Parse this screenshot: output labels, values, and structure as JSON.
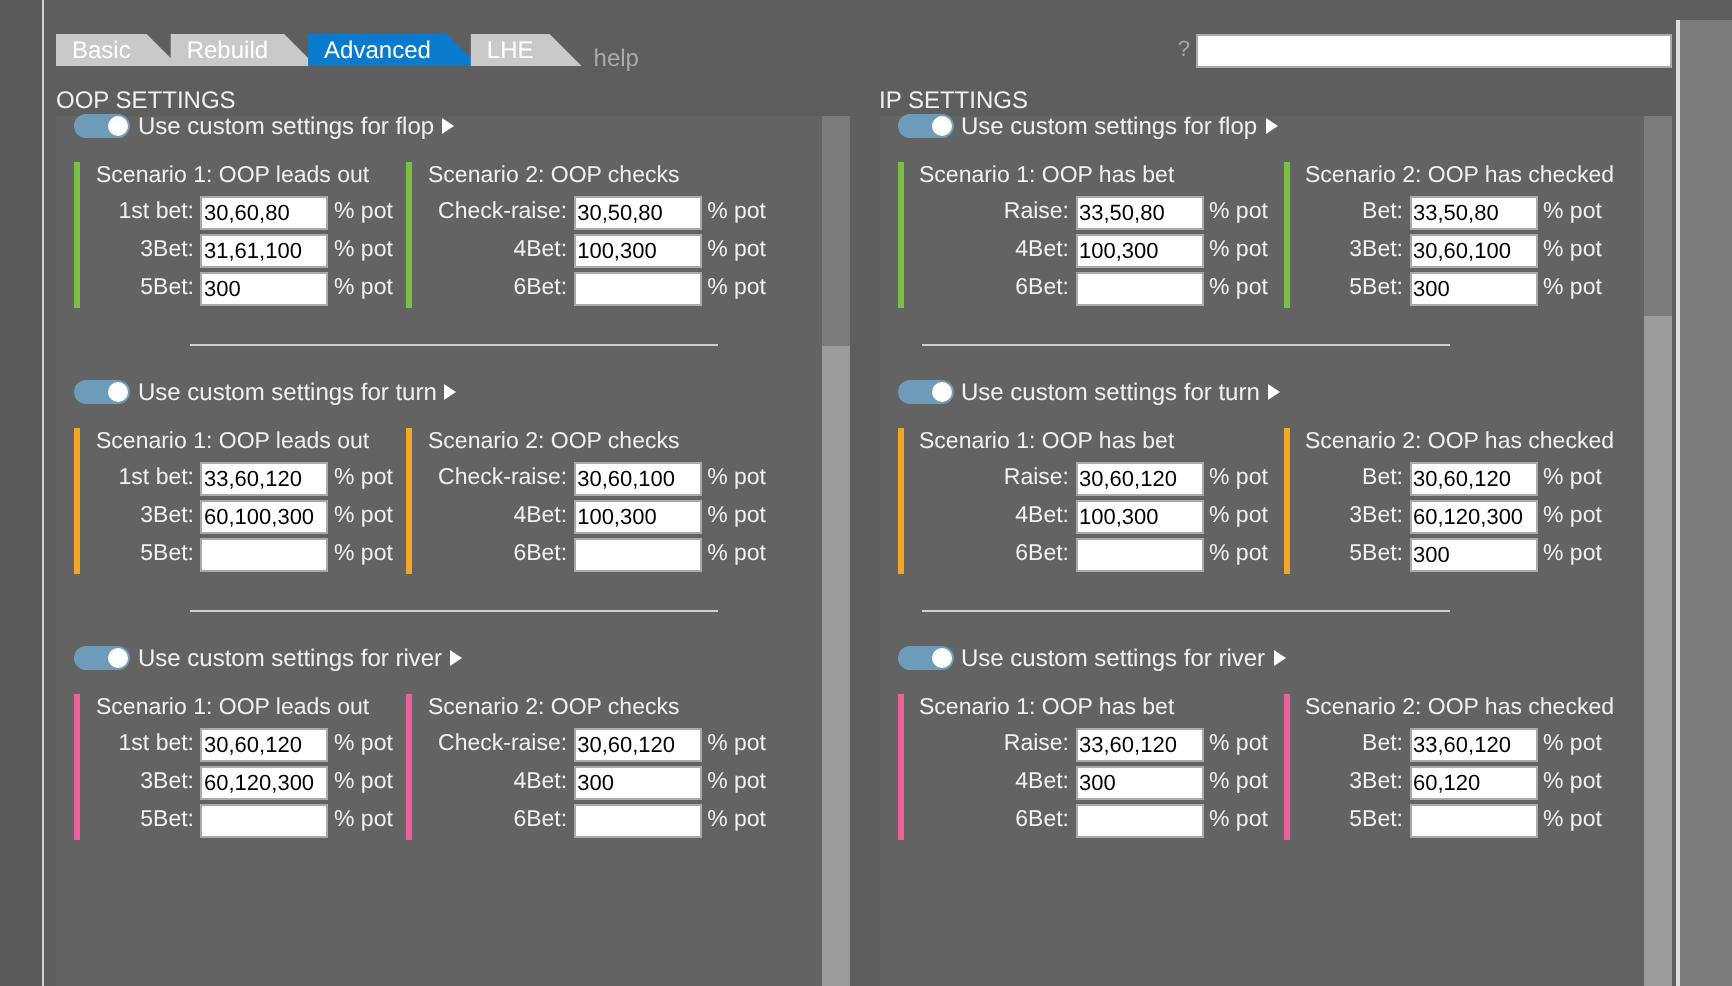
{
  "tabs": [
    {
      "label": "Basic",
      "selected": false
    },
    {
      "label": "Rebuild",
      "selected": false
    },
    {
      "label": "Advanced",
      "selected": true
    },
    {
      "label": "LHE",
      "selected": false
    }
  ],
  "help": "help",
  "search": {
    "label": "?"
  },
  "panels": [
    {
      "title": "OOP SETTINGS",
      "streets": [
        {
          "label": "Use custom settings for flop",
          "on": true,
          "color": "#7ac143",
          "scenarios": [
            {
              "title": "Scenario 1: OOP leads out",
              "rows": [
                {
                  "label": "1st bet:",
                  "value": "30,60,80",
                  "unit": "% pot"
                },
                {
                  "label": "3Bet:",
                  "value": "31,61,100",
                  "unit": "% pot"
                },
                {
                  "label": "5Bet:",
                  "value": "300",
                  "unit": "% pot"
                }
              ]
            },
            {
              "title": "Scenario 2: OOP checks",
              "rows": [
                {
                  "label": "Check-raise:",
                  "value": "30,50,80",
                  "unit": "% pot"
                },
                {
                  "label": "4Bet:",
                  "value": "100,300",
                  "unit": "% pot"
                },
                {
                  "label": "6Bet:",
                  "unit": "% pot"
                }
              ]
            }
          ]
        },
        {
          "label": "Use custom settings for turn",
          "on": true,
          "color": "#f5a623",
          "scenarios": [
            {
              "title": "Scenario 1: OOP leads out",
              "rows": [
                {
                  "label": "1st bet:",
                  "value": "33,60,120",
                  "unit": "% pot"
                },
                {
                  "label": "3Bet:",
                  "value": "60,100,300",
                  "unit": "% pot"
                },
                {
                  "label": "5Bet:",
                  "unit": "% pot"
                }
              ]
            },
            {
              "title": "Scenario 2: OOP checks",
              "rows": [
                {
                  "label": "Check-raise:",
                  "value": "30,60,100",
                  "unit": "% pot"
                },
                {
                  "label": "4Bet:",
                  "value": "100,300",
                  "unit": "% pot"
                },
                {
                  "label": "6Bet:",
                  "unit": "% pot"
                }
              ]
            }
          ]
        },
        {
          "label": "Use custom settings for river",
          "on": true,
          "color": "#f0609e",
          "scenarios": [
            {
              "title": "Scenario 1: OOP leads out",
              "rows": [
                {
                  "label": "1st bet:",
                  "value": "30,60,120",
                  "unit": "% pot"
                },
                {
                  "label": "3Bet:",
                  "value": "60,120,300",
                  "unit": "% pot"
                },
                {
                  "label": "5Bet:",
                  "unit": "% pot"
                }
              ]
            },
            {
              "title": "Scenario 2: OOP checks",
              "rows": [
                {
                  "label": "Check-raise:",
                  "value": "30,60,120",
                  "unit": "% pot"
                },
                {
                  "label": "4Bet:",
                  "value": "300",
                  "unit": "% pot"
                },
                {
                  "label": "6Bet:",
                  "unit": "% pot"
                }
              ]
            }
          ]
        }
      ]
    },
    {
      "title": "IP SETTINGS",
      "streets": [
        {
          "label": "Use custom settings for flop",
          "on": true,
          "color": "#7ac143",
          "scenarios": [
            {
              "title": "Scenario 1: OOP has bet",
              "rows": [
                {
                  "label": "Raise:",
                  "value": "33,50,80",
                  "unit": "% pot"
                },
                {
                  "label": "4Bet:",
                  "value": "100,300",
                  "unit": "% pot"
                },
                {
                  "label": "6Bet:",
                  "unit": "% pot"
                }
              ]
            },
            {
              "title": "Scenario 2: OOP has checked",
              "rows": [
                {
                  "label": "Bet:",
                  "value": "33,50,80",
                  "unit": "% pot"
                },
                {
                  "label": "3Bet:",
                  "value": "30,60,100",
                  "unit": "% pot"
                },
                {
                  "label": "5Bet:",
                  "value": "300",
                  "unit": "% pot"
                }
              ]
            }
          ]
        },
        {
          "label": "Use custom settings for turn",
          "on": true,
          "color": "#f5a623",
          "scenarios": [
            {
              "title": "Scenario 1: OOP has bet",
              "rows": [
                {
                  "label": "Raise:",
                  "value": "30,60,120",
                  "unit": "% pot"
                },
                {
                  "label": "4Bet:",
                  "value": "100,300",
                  "unit": "% pot"
                },
                {
                  "label": "6Bet:",
                  "unit": "% pot"
                }
              ]
            },
            {
              "title": "Scenario 2: OOP has checked",
              "rows": [
                {
                  "label": "Bet:",
                  "value": "30,60,120",
                  "unit": "% pot"
                },
                {
                  "label": "3Bet:",
                  "value": "60,120,300",
                  "unit": "% pot"
                },
                {
                  "label": "5Bet:",
                  "value": "300",
                  "unit": "% pot"
                }
              ]
            }
          ]
        },
        {
          "label": "Use custom settings for river",
          "on": true,
          "color": "#f0609e",
          "scenarios": [
            {
              "title": "Scenario 1: OOP has bet",
              "rows": [
                {
                  "label": "Raise:",
                  "value": "33,60,120",
                  "unit": "% pot"
                },
                {
                  "label": "4Bet:",
                  "value": "300",
                  "unit": "% pot"
                },
                {
                  "label": "6Bet:",
                  "unit": "% pot"
                }
              ]
            },
            {
              "title": "Scenario 2: OOP has checked",
              "rows": [
                {
                  "label": "Bet:",
                  "value": "33,60,120",
                  "unit": "% pot"
                },
                {
                  "label": "3Bet:",
                  "value": "60,120",
                  "unit": "% pot"
                },
                {
                  "label": "5Bet:",
                  "unit": "% pot"
                }
              ]
            }
          ]
        }
      ]
    }
  ]
}
